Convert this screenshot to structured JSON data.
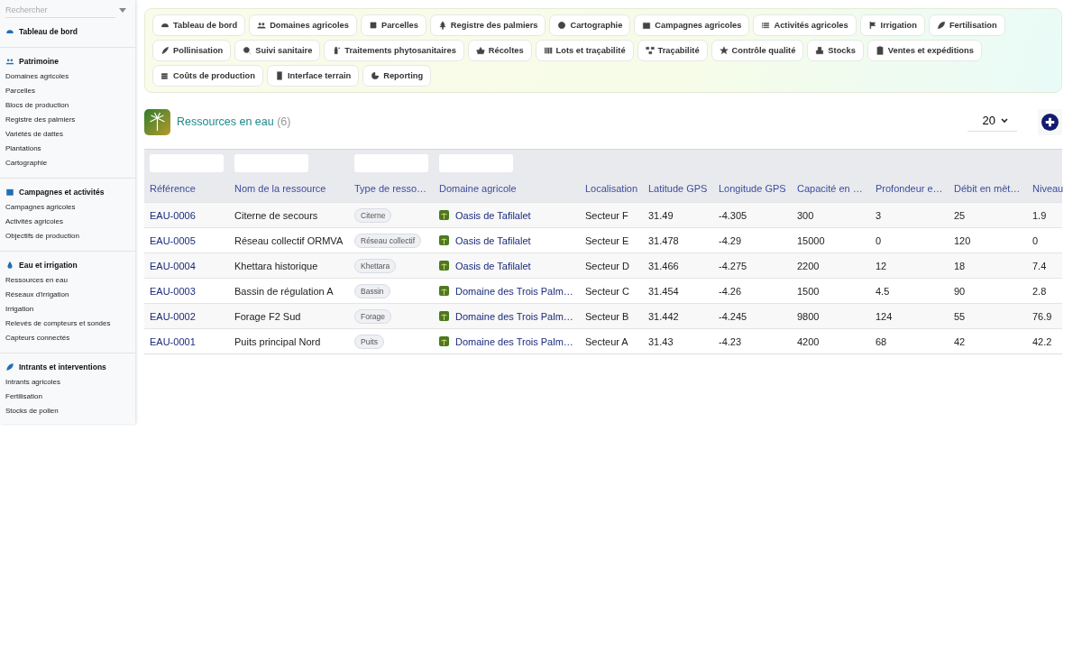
{
  "sidebar": {
    "search": {
      "placeholder": "Rechercher"
    },
    "groups": [
      {
        "title": "Tableau de bord"
      },
      {
        "title": "Patrimoine",
        "items": [
          "Domaines agricoles",
          "Parcelles",
          "Blocs de production",
          "Registre des palmiers",
          "Variétés de dattes",
          "Plantations",
          "Cartographie"
        ]
      },
      {
        "title": "Campagnes et activités",
        "items": [
          "Campagnes agricoles",
          "Activités agricoles",
          "Objectifs de production"
        ]
      },
      {
        "title": "Eau et irrigation",
        "items": [
          "Ressources en eau",
          "Réseaux d'irrigation",
          "Irrigation",
          "Relevés de compteurs et sondes",
          "Capteurs connectés"
        ]
      },
      {
        "title": "Intrants et interventions",
        "items": [
          "Intrants agricoles",
          "Fertilisation",
          "Stocks de pollen"
        ]
      }
    ]
  },
  "nav": [
    "Tableau de bord",
    "Domaines agricoles",
    "Parcelles",
    "Registre des palmiers",
    "Cartographie",
    "Campagnes agricoles",
    "Activités agricoles",
    "Irrigation",
    "Fertilisation",
    "Pollinisation",
    "Suivi sanitaire",
    "Traitements phytosanitaires",
    "Récoltes",
    "Lots et traçabilité",
    "Traçabilité",
    "Contrôle qualité",
    "Stocks",
    "Ventes et expéditions",
    "Coûts de production",
    "Interface terrain",
    "Reporting"
  ],
  "header": {
    "title": "Ressources en eau",
    "count": "(6)",
    "page_size": "20"
  },
  "table": {
    "columns": [
      {
        "label": "Référence",
        "filter": true
      },
      {
        "label": "Nom de la ressource",
        "filter": true
      },
      {
        "label": "Type de resso…",
        "filter": true
      },
      {
        "label": "Domaine agricole",
        "filter": true
      },
      {
        "label": "Localisation",
        "filter": false
      },
      {
        "label": "Latitude GPS",
        "filter": false
      },
      {
        "label": "Longitude GPS",
        "filter": false
      },
      {
        "label": "Capacité en …",
        "filter": false
      },
      {
        "label": "Profondeur e…",
        "filter": false
      },
      {
        "label": "Débit en mèt…",
        "filter": false
      },
      {
        "label": "Niveau",
        "filter": false
      }
    ],
    "rows": [
      [
        "EAU-0006",
        "Citerne de secours",
        "Citerne",
        "Oasis de Tafilalet",
        "Secteur F",
        "31.49",
        "-4.305",
        "300",
        "3",
        "25",
        "1.9"
      ],
      [
        "EAU-0005",
        "Réseau collectif ORMVA",
        "Réseau collectif",
        "Oasis de Tafilalet",
        "Secteur E",
        "31.478",
        "-4.29",
        "15000",
        "0",
        "120",
        "0"
      ],
      [
        "EAU-0004",
        "Khettara historique",
        "Khettara",
        "Oasis de Tafilalet",
        "Secteur D",
        "31.466",
        "-4.275",
        "2200",
        "12",
        "18",
        "7.4"
      ],
      [
        "EAU-0003",
        "Bassin de régulation A",
        "Bassin",
        "Domaine des Trois Palm…",
        "Secteur C",
        "31.454",
        "-4.26",
        "1500",
        "4.5",
        "90",
        "2.8"
      ],
      [
        "EAU-0002",
        "Forage F2 Sud",
        "Forage",
        "Domaine des Trois Palm…",
        "Secteur B",
        "31.442",
        "-4.245",
        "9800",
        "124",
        "55",
        "76.9"
      ],
      [
        "EAU-0001",
        "Puits principal Nord",
        "Puits",
        "Domaine des Trois Palm…",
        "Secteur A",
        "31.43",
        "-4.23",
        "4200",
        "68",
        "42",
        "42.2"
      ]
    ]
  }
}
